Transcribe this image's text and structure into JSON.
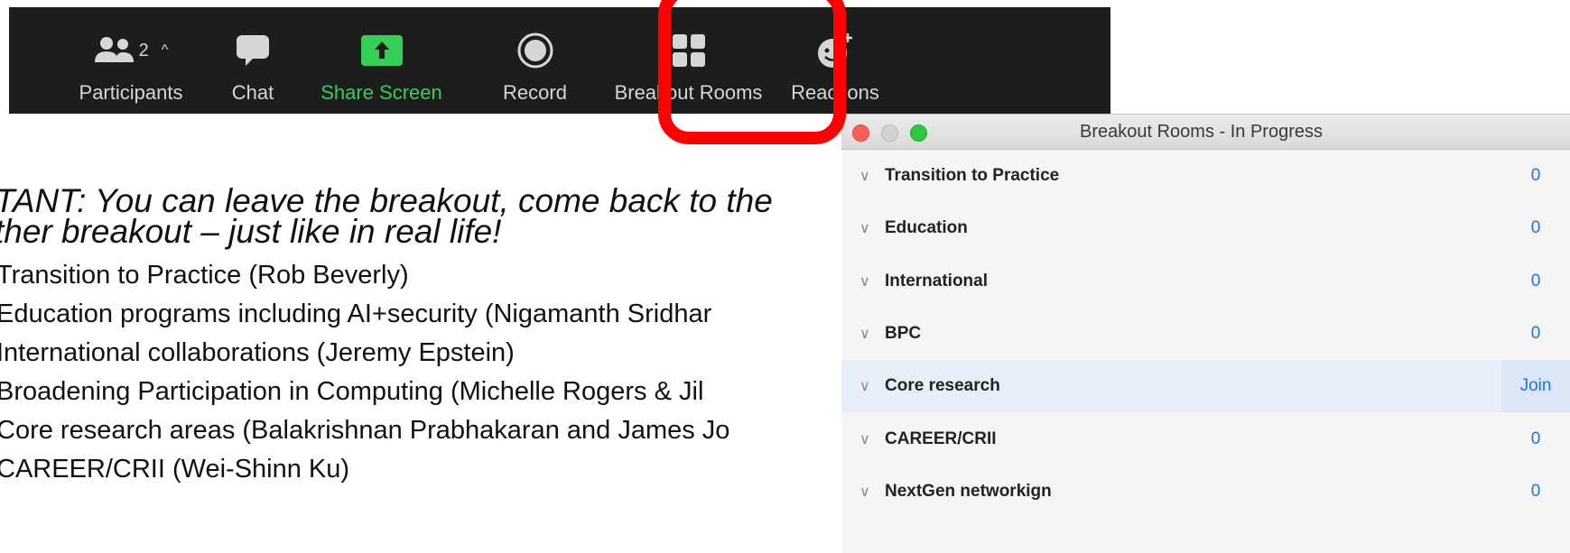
{
  "toolbar": {
    "participants": {
      "label": "Participants",
      "count": "2"
    },
    "chat": {
      "label": "Chat"
    },
    "share": {
      "label": "Share Screen"
    },
    "record": {
      "label": "Record"
    },
    "breakout": {
      "label": "Breakout Rooms"
    },
    "reactions": {
      "label": "Reactions"
    }
  },
  "icons": [
    "participants-icon",
    "chat-icon",
    "share-screen-icon",
    "record-icon",
    "breakout-rooms-icon",
    "reactions-icon"
  ],
  "colors": {
    "toolbar_bg": "#1d1d1d",
    "share_green": "#34d058",
    "highlight_red": "#ff0000",
    "link_blue": "#1a73e8"
  },
  "slide": {
    "important": "TANT: You can leave the breakout, come back to the",
    "important2": "ther breakout – just like in real life!",
    "items": [
      "Transition to Practice (Rob Beverly)",
      "Education programs including AI+security (Nigamanth Sridhar",
      "International collaborations (Jeremy Epstein)",
      "Broadening Participation in Computing (Michelle Rogers & Jil",
      "Core research areas (Balakrishnan Prabhakaran and James Jo",
      "CAREER/CRII (Wei-Shinn Ku)"
    ]
  },
  "window": {
    "title": "Breakout Rooms - In Progress",
    "rooms": [
      {
        "name": "Transition to Practice",
        "count": "0"
      },
      {
        "name": "Education",
        "count": "0"
      },
      {
        "name": "International",
        "count": "0"
      },
      {
        "name": "BPC",
        "count": "0"
      },
      {
        "name": "Core research",
        "count": "Join"
      },
      {
        "name": "CAREER/CRII",
        "count": "0"
      },
      {
        "name": "NextGen networkign",
        "count": "0"
      }
    ]
  }
}
